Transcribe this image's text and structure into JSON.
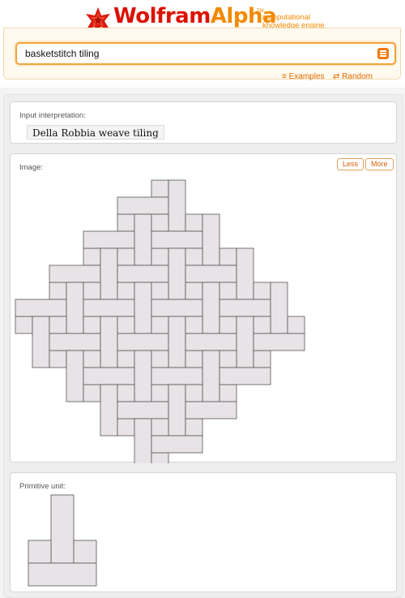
{
  "header": {
    "logo_wolfram": "Wolfram",
    "logo_alpha": "Alpha",
    "tm": "TM",
    "tagline_1": "computational",
    "tagline_2": "knowledge engine"
  },
  "search": {
    "query": "basketstitch tiling"
  },
  "links": {
    "examples": "Examples",
    "random": "Random"
  },
  "pods": {
    "input": {
      "title": "Input interpretation:",
      "value": "Della Robbia weave tiling"
    },
    "image": {
      "title": "Image:",
      "less_label": "Less",
      "more_label": "More"
    },
    "primitive": {
      "title": "Primitive unit:"
    }
  },
  "colors": {
    "brand_red": "#dd1100",
    "brand_orange": "#f28a00",
    "tile_fill": "#e8e3e6",
    "tile_stroke": "#555555"
  }
}
